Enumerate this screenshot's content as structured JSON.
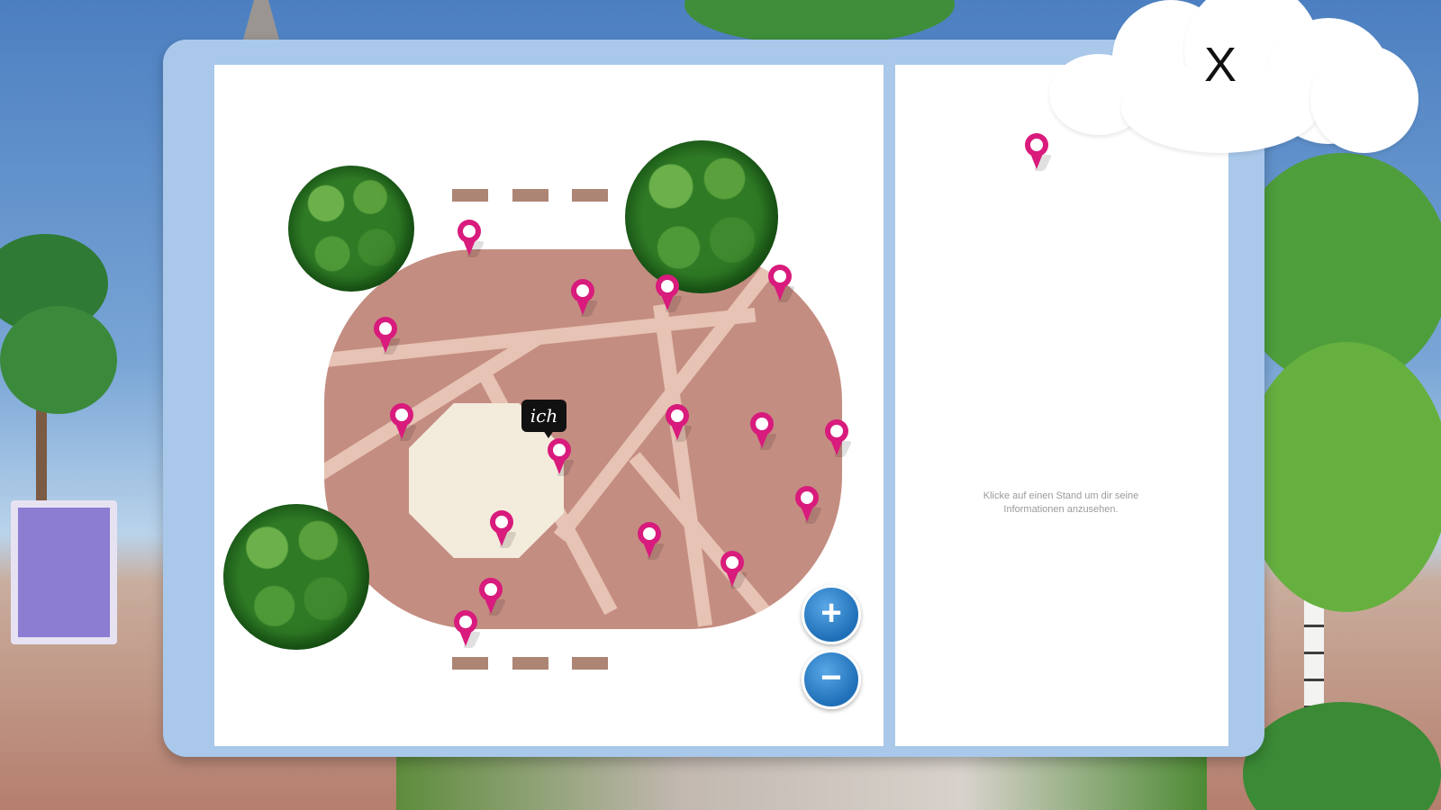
{
  "close_button": {
    "label": "X"
  },
  "map": {
    "me_marker_label": "ich",
    "zoom_in_label": "+",
    "zoom_out_label": "−",
    "stand_pins": [
      "stand-1",
      "stand-2",
      "stand-3",
      "stand-4",
      "stand-5",
      "stand-6",
      "stand-7",
      "stand-8",
      "stand-9",
      "stand-10",
      "stand-11",
      "stand-12",
      "stand-13",
      "stand-14",
      "stand-15",
      "stand-16",
      "stand-17",
      "stand-18"
    ]
  },
  "info_panel": {
    "hint": "Klicke auf einen Stand um dir seine Informationen anzusehen."
  },
  "colors": {
    "pin": "#d81b7c",
    "plaza": "#c48d81",
    "panel_frame": "#a9c8ea",
    "zoom_button": "#1f6fb8"
  }
}
